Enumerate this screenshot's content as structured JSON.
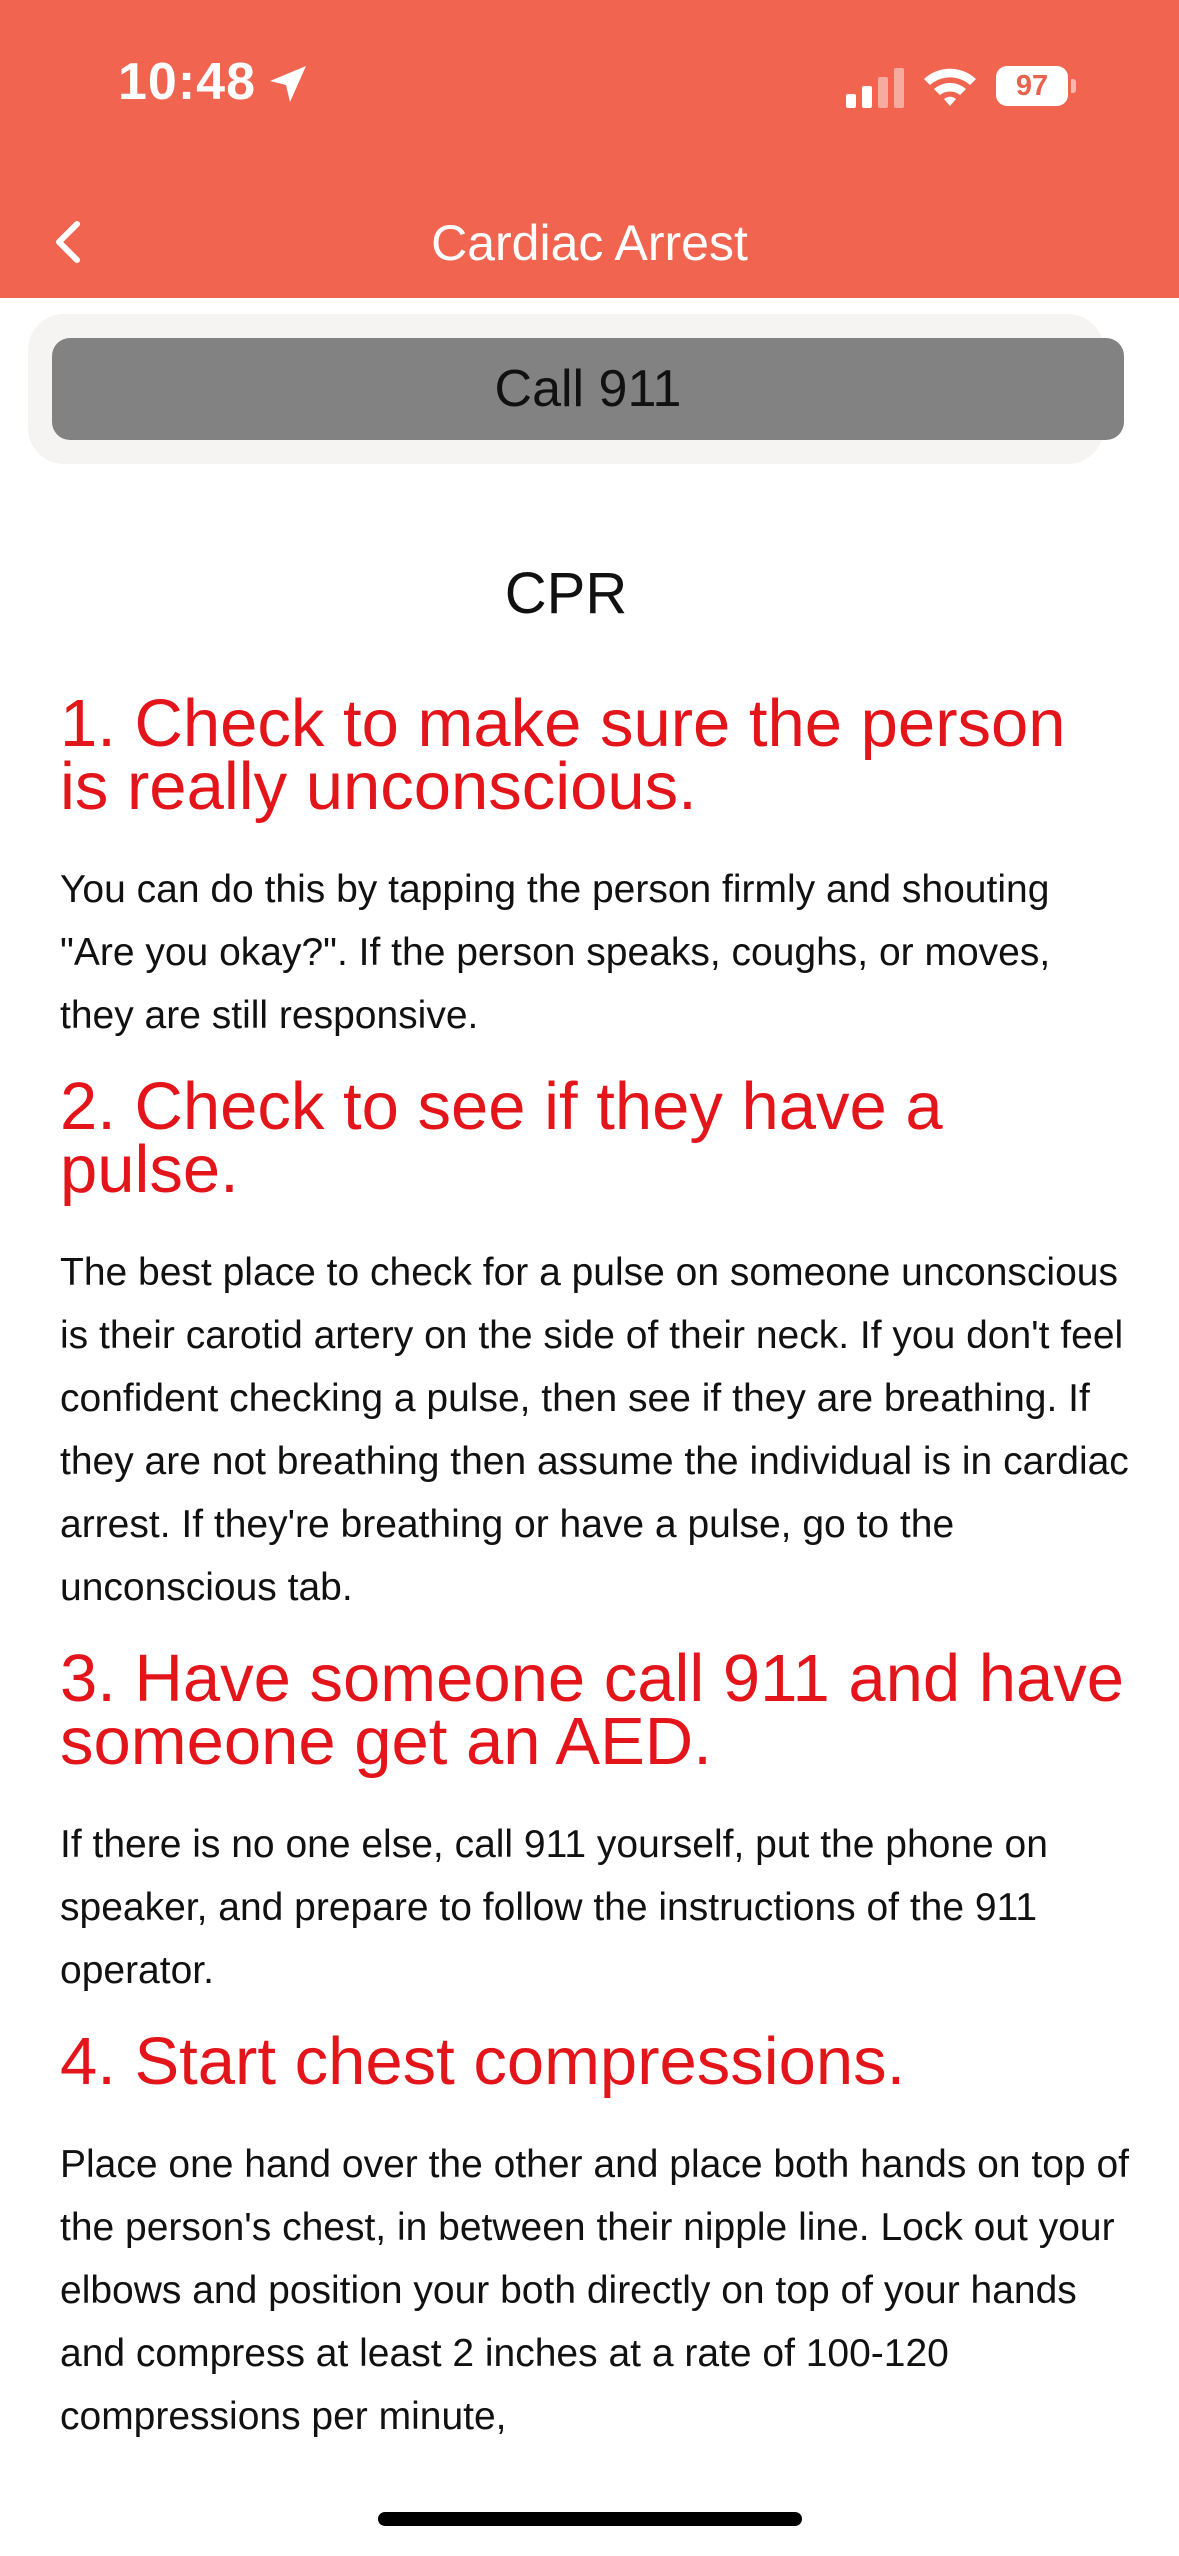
{
  "colors": {
    "header_bg": "#F06450",
    "accent_red": "#E3151B",
    "call_button_bg": "#828282"
  },
  "status_bar": {
    "time": "10:48",
    "battery": "97",
    "icons": [
      "location-arrow-icon",
      "signal-icon",
      "wifi-icon",
      "battery-icon"
    ]
  },
  "nav": {
    "title": "Cardiac Arrest",
    "back_icon": "chevron-left-icon"
  },
  "call_button": {
    "label": "Call 911"
  },
  "section": {
    "title": "CPR"
  },
  "steps": [
    {
      "heading": "1. Check to make sure the person is really unconscious.",
      "body": "You can do this by tapping the person firmly and shouting \"Are you okay?\". If the person speaks, coughs, or moves, they are still responsive."
    },
    {
      "heading": "2. Check to see if they have a pulse.",
      "body": "The best place to check for a pulse on someone unconscious is their carotid artery on the side of their neck. If you don't feel confident checking a pulse, then see if they are breathing. If they are not breathing then assume the individual is in cardiac arrest. If they're breathing or have a pulse, go to the unconscious tab."
    },
    {
      "heading": "3. Have someone call 911 and have someone get an AED.",
      "body": "If there is no one else, call 911 yourself, put the phone on speaker, and prepare to follow the instructions of the 911 operator."
    },
    {
      "heading": "4. Start chest compressions.",
      "body": "Place one hand over the other and place both hands on top of the person's chest, in between their nipple line. Lock out your elbows and position your both directly on top of your hands and compress at least 2 inches at a rate of 100-120 compressions per minute,"
    }
  ]
}
